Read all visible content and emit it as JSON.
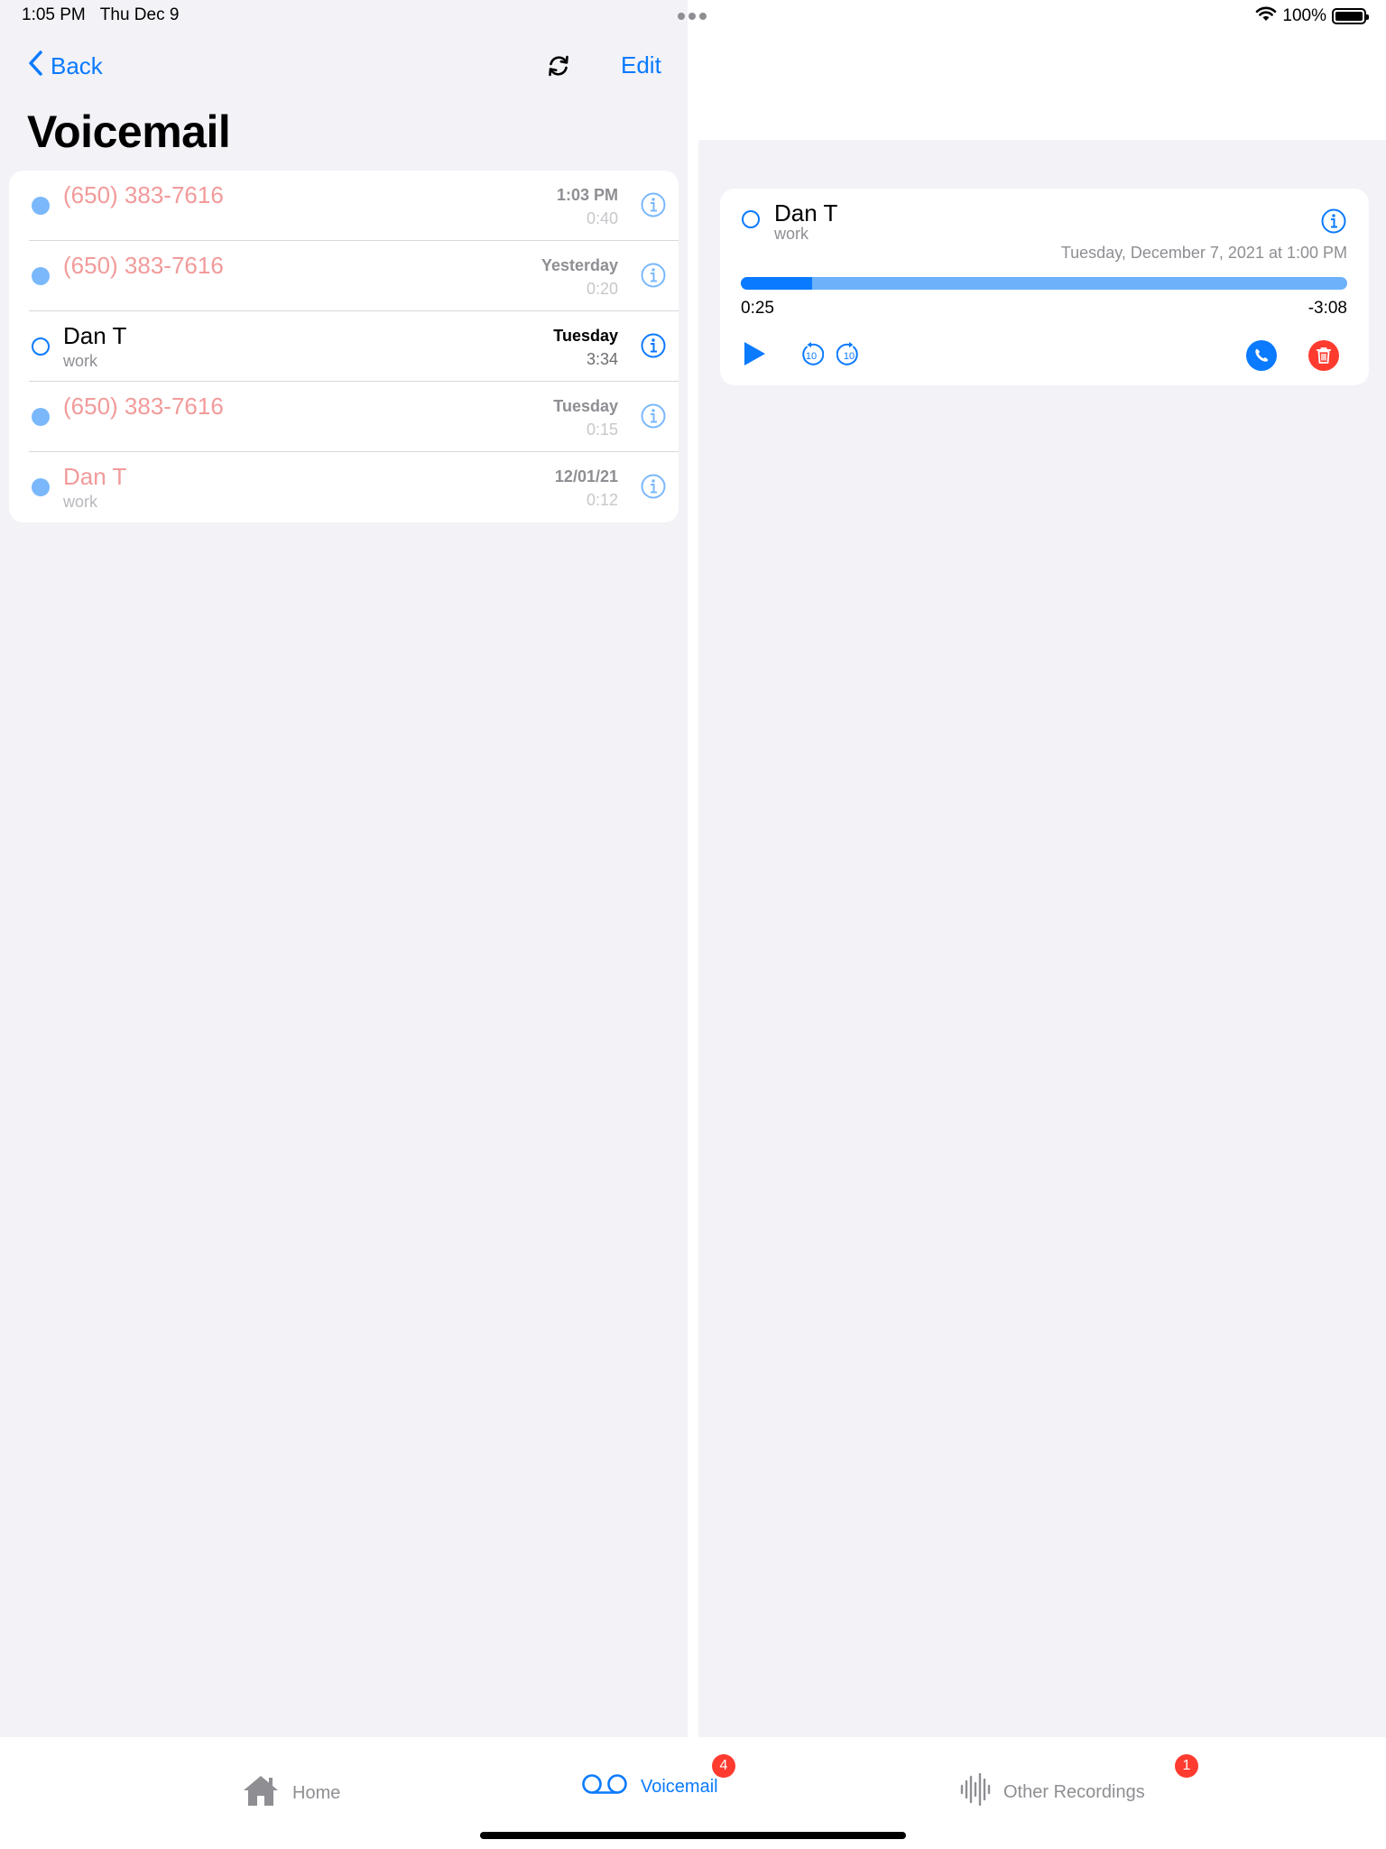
{
  "status": {
    "time": "1:05 PM",
    "date": "Thu Dec 9",
    "battery": "100%"
  },
  "nav": {
    "back_label": "Back",
    "edit_label": "Edit"
  },
  "page": {
    "title": "Voicemail"
  },
  "voicemails": [
    {
      "name": "(650) 383-7616",
      "sub": "",
      "date": "1:03 PM",
      "duration": "0:40",
      "status": "unheard"
    },
    {
      "name": "(650) 383-7616",
      "sub": "",
      "date": "Yesterday",
      "duration": "0:20",
      "status": "unheard"
    },
    {
      "name": "Dan T",
      "sub": "work",
      "date": "Tuesday",
      "duration": "3:34",
      "status": "selected"
    },
    {
      "name": "(650) 383-7616",
      "sub": "",
      "date": "Tuesday",
      "duration": "0:15",
      "status": "unheard"
    },
    {
      "name": "Dan T",
      "sub": "work",
      "date": "12/01/21",
      "duration": "0:12",
      "status": "unheard"
    }
  ],
  "detail": {
    "name": "Dan T",
    "sub": "work",
    "datetime": "Tuesday, December 7, 2021 at 1:00 PM",
    "elapsed": "0:25",
    "remaining": "-3:08",
    "progress_fraction": 0.118,
    "skip_seconds": "10"
  },
  "tabs": [
    {
      "label": "Home",
      "icon": "house-icon",
      "badge": ""
    },
    {
      "label": "Voicemail",
      "icon": "voicemail-icon",
      "badge": "4"
    },
    {
      "label": "Other Recordings",
      "icon": "waveform-icon",
      "badge": "1"
    }
  ],
  "colors": {
    "accent": "#0a7aff",
    "unheard_dot": "#7ab8fb",
    "dimmed_name": "#f29a9a",
    "delete": "#ff3b30",
    "badge": "#ff3b30"
  }
}
